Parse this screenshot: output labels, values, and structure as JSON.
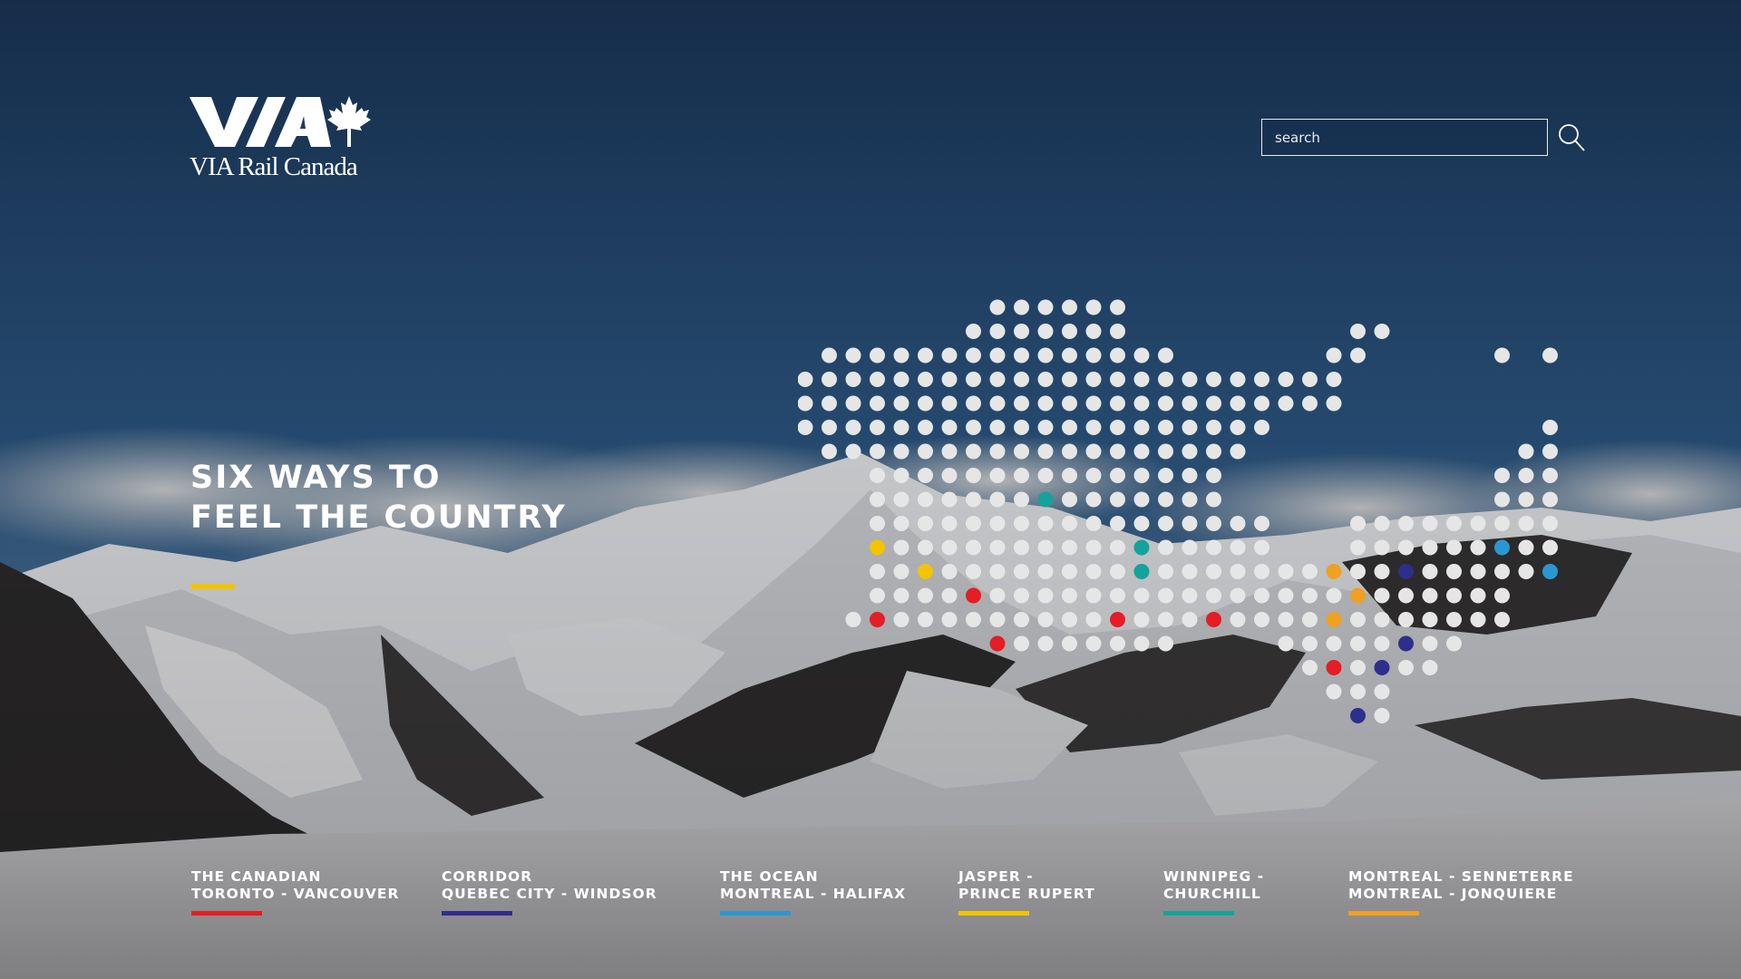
{
  "brand": {
    "name": "VIA Rail Canada",
    "logo_mark": "VIA",
    "wordmark": "VIA Rail Canada",
    "icon": "maple-leaf-icon"
  },
  "search": {
    "placeholder": "search",
    "value": "",
    "icon": "search-icon"
  },
  "hero": {
    "headline_line1": "SIX WAYS TO",
    "headline_line2": "FEEL THE COUNTRY",
    "accent_color": "#f3c300"
  },
  "map": {
    "description_icon": "canada-dot-map",
    "dot_color": "#e6e6e6",
    "stop_colors": [
      "#e31e24",
      "#2e2e8c",
      "#2a97d3",
      "#f3c300",
      "#14a39a",
      "#f0a023"
    ]
  },
  "routes": [
    {
      "line1": "THE CANADIAN",
      "line2": "TORONTO - VANCOUVER",
      "color": "#e31e24"
    },
    {
      "line1": "CORRIDOR",
      "line2": "QUEBEC CITY - WINDSOR",
      "color": "#2e2e8c"
    },
    {
      "line1": "THE OCEAN",
      "line2": "MONTREAL - HALIFAX",
      "color": "#2a97d3"
    },
    {
      "line1": "JASPER -",
      "line2": "PRINCE RUPERT",
      "color": "#f3c300"
    },
    {
      "line1": "WINNIPEG -",
      "line2": "CHURCHILL",
      "color": "#14a39a"
    },
    {
      "line1": "MONTREAL - SENNETERRE",
      "line2": "MONTREAL - JONQUIERE",
      "color": "#f0a023"
    }
  ]
}
